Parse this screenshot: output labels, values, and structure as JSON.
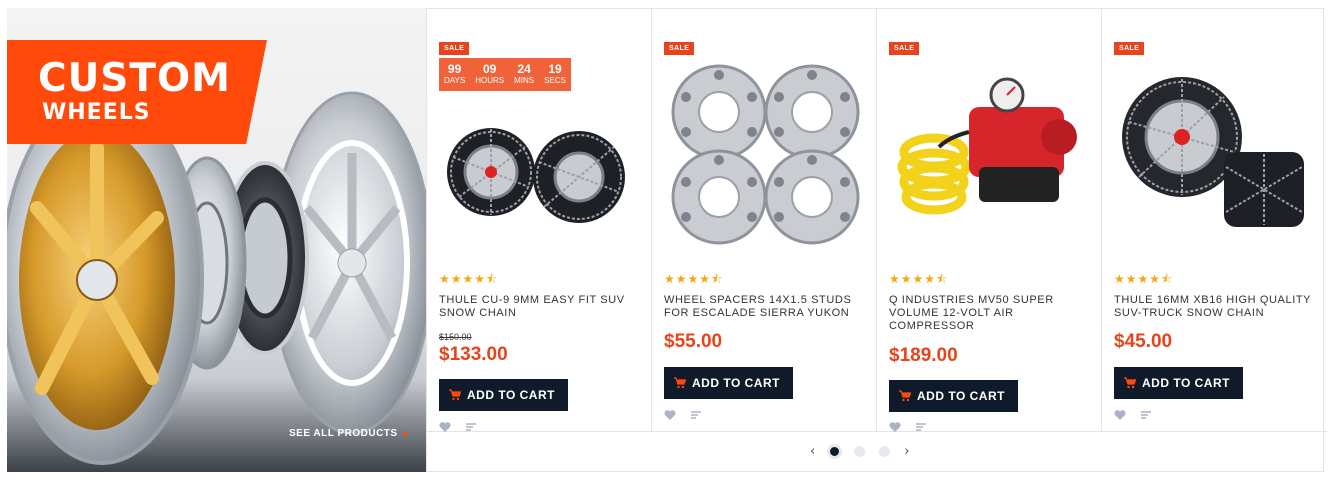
{
  "banner": {
    "title": "CUSTOM",
    "subtitle": "WHEELS",
    "see_all": "SEE ALL PRODUCTS",
    "see_all_arrow": "▸"
  },
  "colors": {
    "accent": "#ff4a0c",
    "sale": "#e8441c",
    "dark": "#0f1b2a",
    "star": "#f3a712"
  },
  "countdown": [
    {
      "value": "99",
      "label": "DAYS"
    },
    {
      "value": "09",
      "label": "HOURS"
    },
    {
      "value": "24",
      "label": "MINS"
    },
    {
      "value": "19",
      "label": "SECS"
    }
  ],
  "products": [
    {
      "badge": "SALE",
      "name": "THULE CU-9 9MM EASY FIT SUV SNOW CHAIN",
      "old_price": "$150.00",
      "price": "$133.00",
      "rating": 4.5,
      "stars": "★★★★⯪",
      "cart_label": "ADD TO CART",
      "icon": "snow-chain"
    },
    {
      "badge": "SALE",
      "name": "WHEEL SPACERS 14X1.5 STUDS FOR ESCALADE SIERRA YUKON",
      "price": "$55.00",
      "rating": 4.5,
      "stars": "★★★★⯪",
      "cart_label": "ADD TO CART",
      "icon": "wheel-spacers"
    },
    {
      "badge": "SALE",
      "name": "Q INDUSTRIES MV50 SUPER VOLUME 12-VOLT AIR COMPRESSOR",
      "price": "$189.00",
      "rating": 4.5,
      "stars": "★★★★⯪",
      "cart_label": "ADD TO CART",
      "icon": "air-compressor"
    },
    {
      "badge": "SALE",
      "name": "THULE 16MM XB16 HIGH QUALITY SUV-TRUCK SNOW CHAIN",
      "price": "$45.00",
      "rating": 4.5,
      "stars": "★★★★⯪",
      "cart_label": "ADD TO CART",
      "icon": "snow-chain-truck"
    }
  ],
  "carousel": {
    "prev": "‹",
    "next": "›",
    "pages": 3,
    "active": 1
  }
}
